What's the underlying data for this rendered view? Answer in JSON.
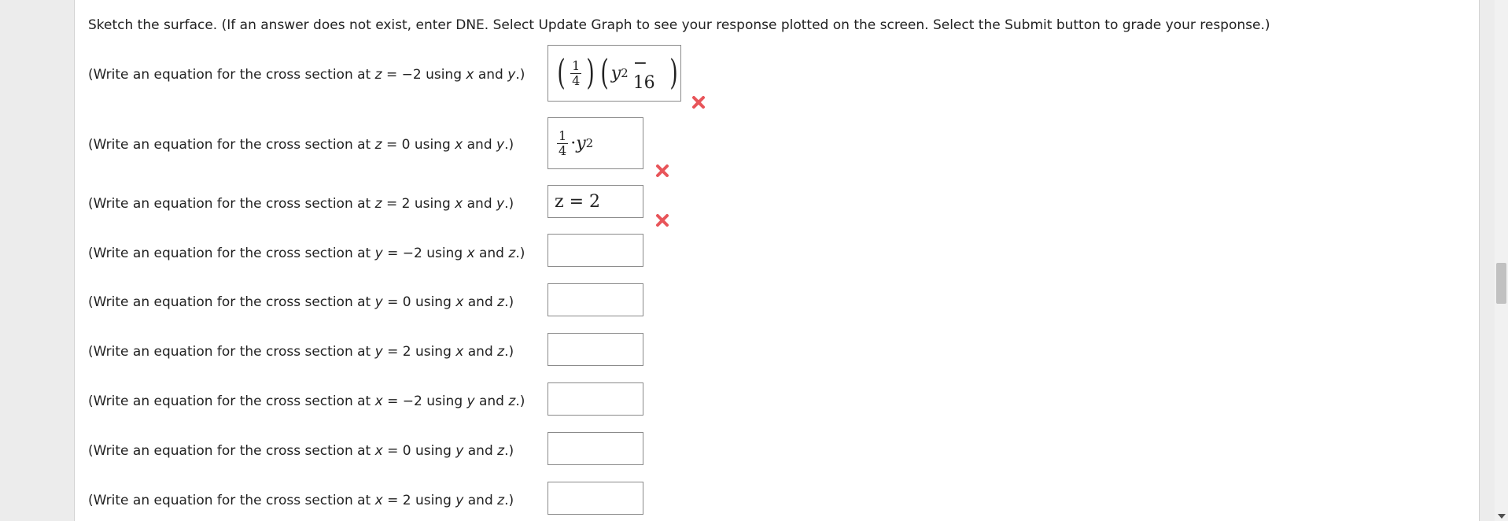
{
  "instructions": "Sketch the surface. (If an answer does not exist, enter DNE. Select Update Graph to see your response plotted on the screen. Select the Submit button to grade your response.)",
  "questions": [
    {
      "pre": "(Write an equation for the cross section at ",
      "var": "z",
      "eq": " = −2 using ",
      "v1": "x",
      "and": " and ",
      "v2": "y",
      "post": ".)"
    },
    {
      "pre": "(Write an equation for the cross section at ",
      "var": "z",
      "eq": " = 0 using ",
      "v1": "x",
      "and": " and ",
      "v2": "y",
      "post": ".)"
    },
    {
      "pre": "(Write an equation for the cross section at ",
      "var": "z",
      "eq": " = 2 using ",
      "v1": "x",
      "and": " and ",
      "v2": "y",
      "post": ".)"
    },
    {
      "pre": "(Write an equation for the cross section at ",
      "var": "y",
      "eq": " = −2 using ",
      "v1": "x",
      "and": " and ",
      "v2": "z",
      "post": ".)"
    },
    {
      "pre": "(Write an equation for the cross section at ",
      "var": "y",
      "eq": " = 0 using ",
      "v1": "x",
      "and": " and ",
      "v2": "z",
      "post": ".)"
    },
    {
      "pre": "(Write an equation for the cross section at ",
      "var": "y",
      "eq": " = 2 using ",
      "v1": "x",
      "and": " and ",
      "v2": "z",
      "post": ".)"
    },
    {
      "pre": "(Write an equation for the cross section at ",
      "var": "x",
      "eq": " = −2 using ",
      "v1": "y",
      "and": " and ",
      "v2": "z",
      "post": ".)"
    },
    {
      "pre": "(Write an equation for the cross section at ",
      "var": "x",
      "eq": " = 0 using ",
      "v1": "y",
      "and": " and ",
      "v2": "z",
      "post": ".)"
    },
    {
      "pre": "(Write an equation for the cross section at ",
      "var": "x",
      "eq": " = 2 using ",
      "v1": "y",
      "and": " and ",
      "v2": "z",
      "post": ".)"
    }
  ],
  "answers": {
    "a1": {
      "frac_num": "1",
      "frac_den": "4",
      "var": "y",
      "exp": "2",
      "minus": "− 16"
    },
    "a2": {
      "frac_num": "1",
      "frac_den": "4",
      "dot": "·",
      "var": "y",
      "exp": "2"
    },
    "a3": {
      "text": "z = 2"
    }
  },
  "wrong_mark": "✕",
  "colors": {
    "wrong": "#e8555a",
    "border": "#8a8a8a"
  }
}
